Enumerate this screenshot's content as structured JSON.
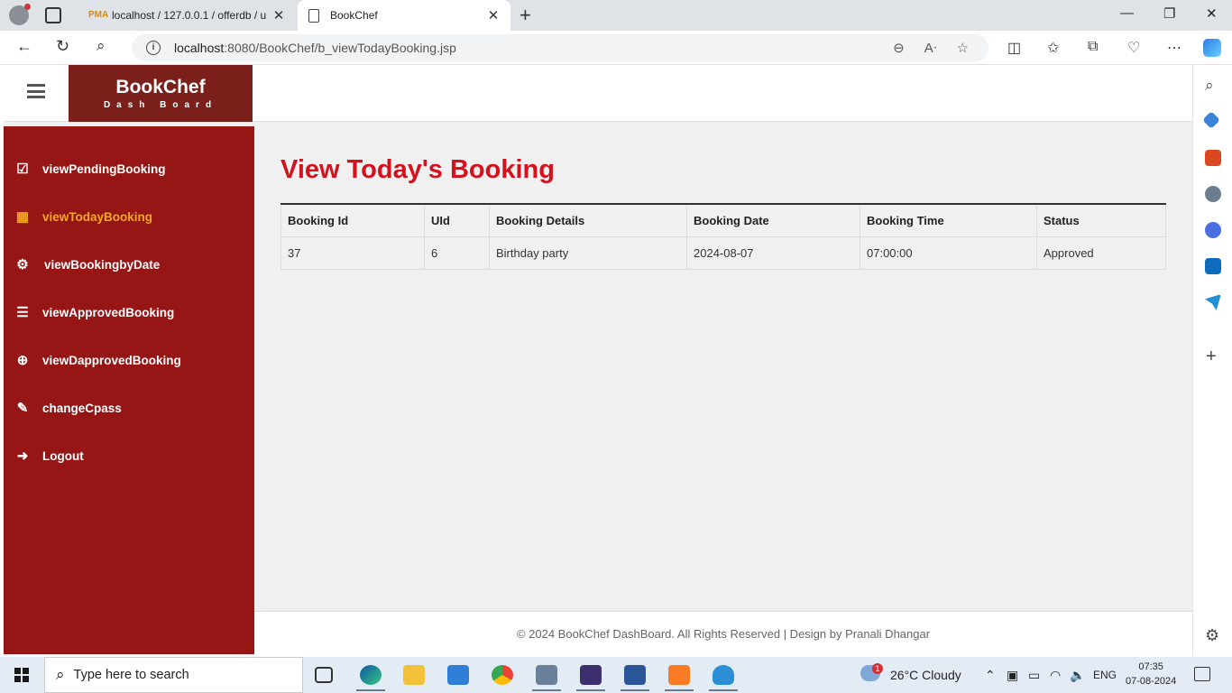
{
  "browser": {
    "tabs": [
      {
        "title": "localhost / 127.0.0.1 / offerdb / u",
        "favicon": "phpmyadmin-icon",
        "favicon_text": "PMA",
        "active": false
      },
      {
        "title": "BookChef",
        "favicon": "page-icon",
        "active": true
      }
    ],
    "url_host": "localhost",
    "url_rest": ":8080/BookChef/b_viewTodayBooking.jsp"
  },
  "app": {
    "brand_name": "BookChef",
    "brand_subtitle": "Dash Board",
    "accent_color": "#961616",
    "active_color": "#f5a623"
  },
  "sidebar": {
    "items": [
      {
        "label": "viewPendingBooking",
        "icon": "check-square-icon",
        "glyph": "☑"
      },
      {
        "label": "viewTodayBooking",
        "icon": "table-icon",
        "glyph": "▦",
        "active": true
      },
      {
        "label": "viewBookingbyDate",
        "icon": "gears-icon",
        "glyph": "⚙"
      },
      {
        "label": "viewApprovedBooking",
        "icon": "list-icon",
        "glyph": "☰"
      },
      {
        "label": "viewDapprovedBooking",
        "icon": "search-plus-icon",
        "glyph": "⊕"
      },
      {
        "label": "changeCpass",
        "icon": "pencil-icon",
        "glyph": "✎"
      },
      {
        "label": "Logout",
        "icon": "sign-out-icon",
        "glyph": "➜"
      }
    ]
  },
  "main": {
    "title": "View Today's Booking",
    "table": {
      "columns": [
        "Booking Id",
        "UId",
        "Booking Details",
        "Booking Date",
        "Booking Time",
        "Status"
      ],
      "rows": [
        [
          "37",
          "6",
          "Birthday party",
          "2024-08-07",
          "07:00:00",
          "Approved"
        ]
      ]
    }
  },
  "footer": {
    "text": "© 2024 BookChef DashBoard. All Rights Reserved | Design by Pranali Dhangar"
  },
  "taskbar": {
    "search_placeholder": "Type here to search",
    "weather": "26°C  Cloudy",
    "weather_badge": "1",
    "language": "ENG",
    "time": "07:35",
    "date": "07-08-2024"
  }
}
